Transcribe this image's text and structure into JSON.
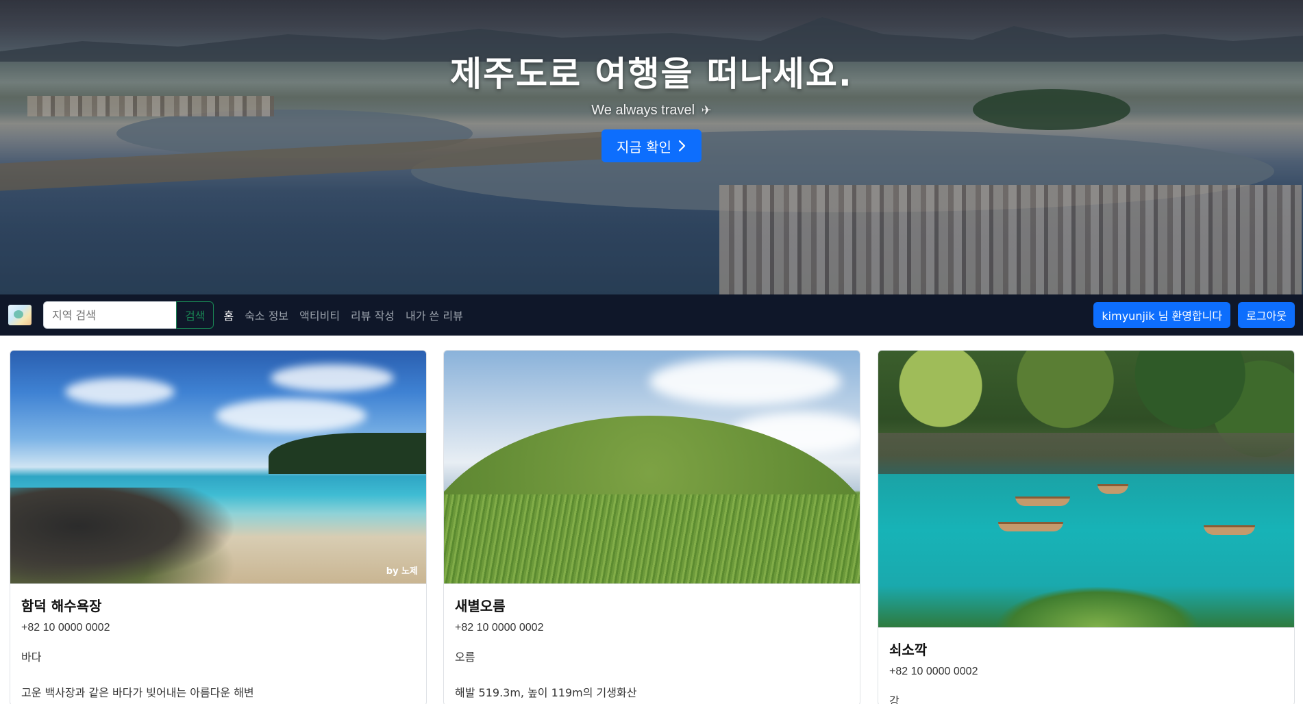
{
  "hero": {
    "title": "제주도로 여행을 떠나세요.",
    "subtitle": "We always travel",
    "subtitle_icon": "airplane-icon",
    "cta_label": "지금 확인",
    "cta_icon": "chevron-right-icon"
  },
  "navbar": {
    "logo": "site-logo",
    "search": {
      "placeholder": "지역 검색",
      "button_label": "검색"
    },
    "links": [
      {
        "label": "홈",
        "active": true
      },
      {
        "label": "숙소 정보",
        "active": false
      },
      {
        "label": "액티비티",
        "active": false
      },
      {
        "label": "리뷰 작성",
        "active": false
      },
      {
        "label": "내가 쓴 리뷰",
        "active": false
      }
    ],
    "welcome_label": "kimyunjik 님 환영합니다",
    "logout_label": "로그아웃"
  },
  "cards": [
    {
      "title": "함덕 해수욕장",
      "phone": "+82 10 0000 0002",
      "category": "바다",
      "description": "고운 백사장과 같은 바다가 빚어내는 아름다운 해변",
      "image_caption": "by 노제"
    },
    {
      "title": "새별오름",
      "phone": "+82 10 0000 0002",
      "category": "오름",
      "description": "해발 519.3m, 높이 119m의 기생화산"
    },
    {
      "title": "쇠소깍",
      "phone": "+82 10 0000 0002",
      "category": "강"
    }
  ],
  "colors": {
    "primary": "#0d6efd",
    "navbar_bg": "#0f1729",
    "success_outline": "#198754"
  }
}
